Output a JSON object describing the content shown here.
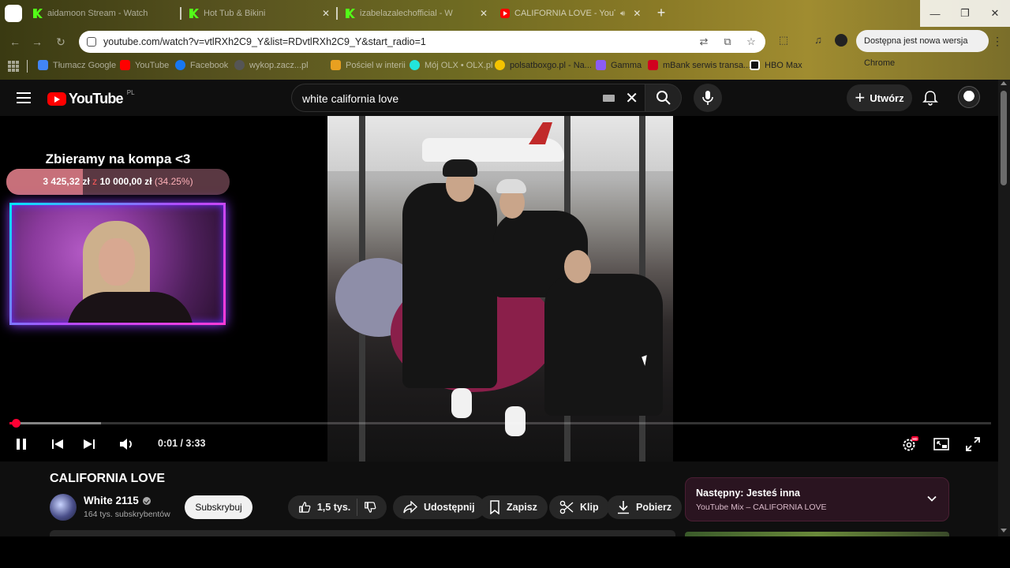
{
  "browser": {
    "tabs": [
      {
        "title": "aidamoon Stream - Watch",
        "icon": "kick-icon"
      },
      {
        "title": "Hot Tub & Bikini",
        "icon": "kick-icon"
      },
      {
        "title": "izabelazalechofficial - W",
        "icon": "kick-icon"
      },
      {
        "title": "CALIFORNIA LOVE - YouTu",
        "icon": "youtube-icon",
        "active": true
      }
    ],
    "window_controls": {
      "minimize": "—",
      "restore": "❐",
      "close": "✕"
    },
    "url": "youtube.com/watch?v=vtlRXh2C9_Y&list=RDvtlRXh2C9_Y&start_radio=1",
    "update_pill": "Dostępna jest nowa wersja Chrome",
    "bookmarks": [
      {
        "label": "Tłumacz Google",
        "color": "#4285f4"
      },
      {
        "label": "YouTube",
        "color": "#ff0000"
      },
      {
        "label": "Facebook",
        "color": "#1877f2"
      },
      {
        "label": "wykop.zacz...pl",
        "color": "#555555"
      },
      {
        "label": "Pościel w interii",
        "color": "#e8a020"
      },
      {
        "label": "Mój OLX • OLX.pl",
        "color": "#23e5db"
      },
      {
        "label": "polsatboxgo.pl - Na...",
        "color": "#f5c400"
      },
      {
        "label": "Gamma",
        "color": "#8b5cf6"
      },
      {
        "label": "mBank serwis transa...",
        "color": "#d1001f"
      },
      {
        "label": "HBO Max",
        "color": "#ffffff"
      }
    ]
  },
  "masthead": {
    "logo_text": "YouTube",
    "country_code": "PL",
    "search_query": "white california love",
    "create_label": "Utwórz"
  },
  "overlay": {
    "goal_title": "Zbieramy na kompa <3",
    "goal_current": "3 425,32 zł",
    "goal_sep": "z",
    "goal_target": "10 000,00 zł",
    "goal_percent_text": "(34.25%)",
    "goal_fraction": 0.3425
  },
  "player": {
    "time_text": "0:01 / 3:33",
    "played_fraction": 0.006,
    "buffered_fraction": 0.093,
    "hd_badge": "HD",
    "accent": "#ff0033"
  },
  "video_info": {
    "title": "CALIFORNIA LOVE",
    "channel_name": "White 2115",
    "subscribers": "164 tys. subskrybentów",
    "subscribe_label": "Subskrybuj",
    "likes": "1,5 tys.",
    "share_label": "Udostępnij",
    "save_label": "Zapisz",
    "clip_label": "Klip",
    "download_label": "Pobierz"
  },
  "up_next": {
    "title": "Następny: Jesteś inna",
    "subtitle": "YouTube Mix – CALIFORNIA LOVE"
  }
}
